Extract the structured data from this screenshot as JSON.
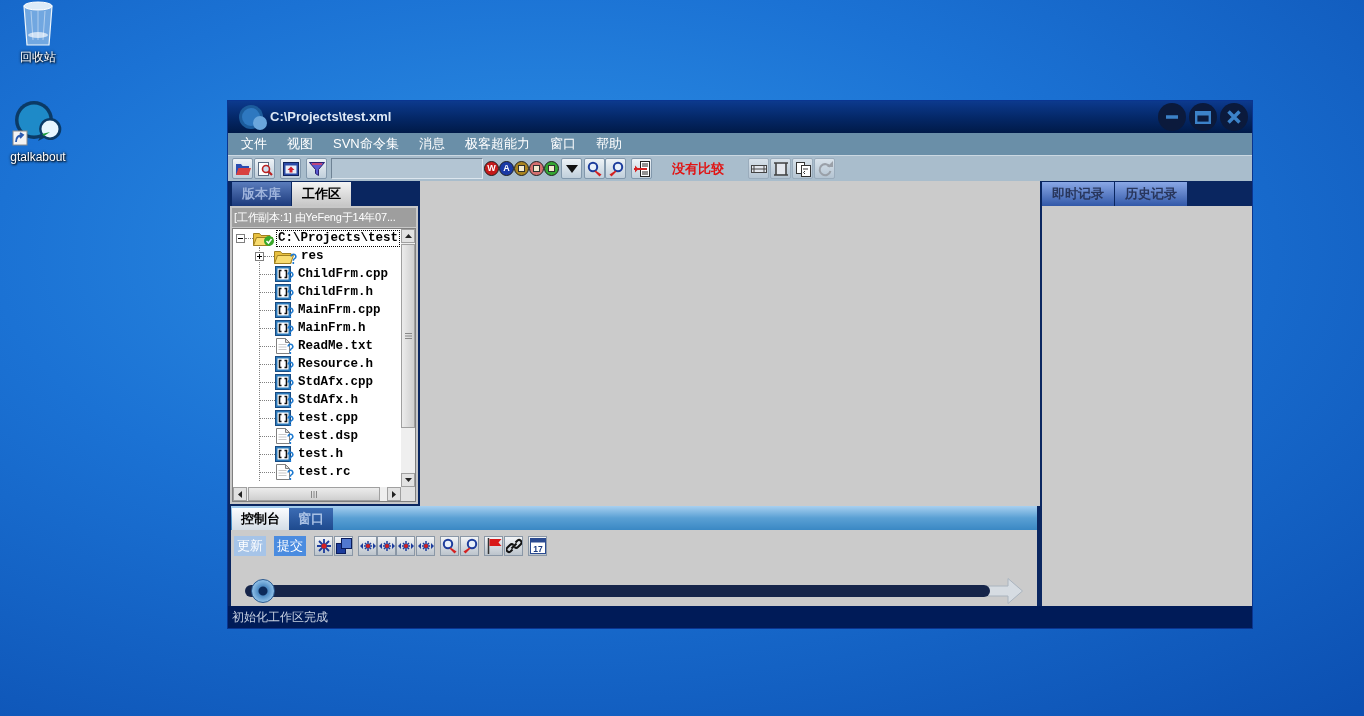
{
  "desktop": {
    "icons": [
      {
        "kind": "recycle-bin",
        "label": "回收站"
      },
      {
        "kind": "shortcut",
        "label": "gtalkabout"
      }
    ]
  },
  "window": {
    "title": "C:\\Projects\\test.xml"
  },
  "menu": [
    {
      "label": "文件"
    },
    {
      "label": "视图"
    },
    {
      "label": "SVN命令集"
    },
    {
      "label": "消息"
    },
    {
      "label": "极客超能力"
    },
    {
      "label": "窗口"
    },
    {
      "label": "帮助"
    }
  ],
  "toolbar": {
    "balls": [
      {
        "glyph": "W",
        "color": "#c41a1a"
      },
      {
        "glyph": "A",
        "color": "#1a3aa6"
      },
      {
        "color": "#a88420"
      },
      {
        "color": "#d47070"
      },
      {
        "color": "#34a632"
      }
    ],
    "compare_status": "没有比较"
  },
  "left_panel": {
    "tabs": [
      {
        "label": "版本库",
        "selected": false
      },
      {
        "label": "工作区",
        "selected": true
      }
    ],
    "info": "[工作副本:1] 由YeFeng于14年07...",
    "tree": {
      "label": "C:\\Projects\\test",
      "kind": "folder",
      "versioned": true,
      "expanded": true,
      "selected": true,
      "children": [
        {
          "label": "res",
          "kind": "folder",
          "versioned": false,
          "expanded": false,
          "selected": false
        },
        {
          "label": "ChildFrm.cpp",
          "kind": "source",
          "versioned": false,
          "selected": false
        },
        {
          "label": "ChildFrm.h",
          "kind": "source",
          "versioned": false,
          "selected": false
        },
        {
          "label": "MainFrm.cpp",
          "kind": "source",
          "versioned": false,
          "selected": false
        },
        {
          "label": "MainFrm.h",
          "kind": "source",
          "versioned": false,
          "selected": false
        },
        {
          "label": "ReadMe.txt",
          "kind": "text",
          "versioned": false,
          "selected": false
        },
        {
          "label": "Resource.h",
          "kind": "source",
          "versioned": false,
          "selected": false
        },
        {
          "label": "StdAfx.cpp",
          "kind": "source",
          "versioned": false,
          "selected": false
        },
        {
          "label": "StdAfx.h",
          "kind": "source",
          "versioned": false,
          "selected": false
        },
        {
          "label": "test.cpp",
          "kind": "source",
          "versioned": false,
          "selected": false
        },
        {
          "label": "test.dsp",
          "kind": "text",
          "versioned": false,
          "selected": false
        },
        {
          "label": "test.h",
          "kind": "source",
          "versioned": false,
          "selected": false
        },
        {
          "label": "test.rc",
          "kind": "text",
          "versioned": false,
          "selected": false
        }
      ]
    }
  },
  "bottom_panel": {
    "tabs": [
      {
        "label": "控制台",
        "selected": true
      },
      {
        "label": "窗口",
        "selected": false
      }
    ],
    "buttons": [
      {
        "label": "更新",
        "disabled": true
      },
      {
        "label": "提交",
        "disabled": false
      }
    ],
    "calendar_day": "17",
    "slider": {
      "level": 0
    }
  },
  "right_panel": {
    "tabs": [
      {
        "label": "即时记录",
        "selected": false
      },
      {
        "label": "历史记录",
        "selected": false
      }
    ]
  },
  "status_bar": {
    "text": "初始化工作区完成"
  }
}
